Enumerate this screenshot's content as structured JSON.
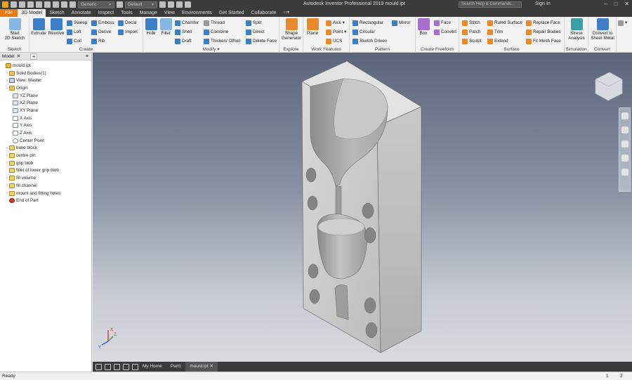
{
  "window": {
    "title": "Autodesk Inventor Professional 2019   mould.ipt",
    "search_placeholder": "Search Help & Commands...",
    "signin": "Sign In",
    "material": "Generic",
    "appearance": "Default"
  },
  "menu": {
    "tabs": [
      "File",
      "3D Model",
      "Sketch",
      "Annotate",
      "Inspect",
      "Tools",
      "Manage",
      "View",
      "Environments",
      "Get Started",
      "Collaborate"
    ]
  },
  "ribbon": {
    "sketch": {
      "label": "Sketch",
      "start": "Start\n2D Sketch"
    },
    "create": {
      "label": "Create",
      "extrude": "Extrude",
      "revolve": "Revolve",
      "sweep": "Sweep",
      "loft": "Loft",
      "coil": "Coil",
      "emboss": "Emboss",
      "derive": "Derive",
      "rib": "Rib",
      "decal": "Decal",
      "import": "Import"
    },
    "modify": {
      "label": "Modify ▾",
      "hole": "Hole",
      "fillet": "Fillet",
      "chamfer": "Chamfer",
      "shell": "Shell",
      "draft": "Draft",
      "thread": "Thread",
      "combine": "Combine",
      "thicken": "Thicken/ Offset",
      "split": "Split",
      "direct": "Direct",
      "delete_face": "Delete Face"
    },
    "explore": {
      "label": "Explore",
      "shape_gen": "Shape\nGenerator"
    },
    "work": {
      "label": "Work Features",
      "plane": "Plane",
      "axis": "Axis ▾",
      "point": "Point ▾",
      "ucs": "UCS"
    },
    "pattern": {
      "label": "Pattern",
      "rectangular": "Rectangular",
      "circular": "Circular",
      "sketch_driven": "Sketch Driven",
      "mirror": "Mirror"
    },
    "freeform": {
      "label": "Create Freeform",
      "box": "Box",
      "face": "Face",
      "convert": "Convert"
    },
    "surface": {
      "label": "Surface",
      "stitch": "Stitch",
      "patch": "Patch",
      "sculpt": "Sculpt",
      "ruled": "Ruled Surface",
      "trim": "Trim",
      "extend": "Extend",
      "replace_face": "Replace Face",
      "repair": "Repair Bodies",
      "fit_mesh": "Fit Mesh Face"
    },
    "simulation": {
      "label": "Simulation",
      "stress": "Stress\nAnalysis"
    },
    "convert": {
      "label": "Convert",
      "sheet_metal": "Convert to\nSheet Metal"
    }
  },
  "browser": {
    "tab": "Model",
    "add": "+",
    "menu": "≡",
    "items": [
      {
        "label": "mould.ipt",
        "indent": 0,
        "icon": "part"
      },
      {
        "label": "Solid Bodies(1)",
        "indent": 1,
        "icon": "folder",
        "exp": "›"
      },
      {
        "label": "View: Master",
        "indent": 1,
        "icon": "view",
        "exp": "›"
      },
      {
        "label": "Origin",
        "indent": 1,
        "icon": "folder",
        "exp": "⌄"
      },
      {
        "label": "YZ Plane",
        "indent": 2,
        "icon": "plane"
      },
      {
        "label": "XZ Plane",
        "indent": 2,
        "icon": "plane"
      },
      {
        "label": "XY Plane",
        "indent": 2,
        "icon": "plane"
      },
      {
        "label": "X Axis",
        "indent": 2,
        "icon": "axis"
      },
      {
        "label": "Y Axis",
        "indent": 2,
        "icon": "axis"
      },
      {
        "label": "Z Axis",
        "indent": 2,
        "icon": "axis"
      },
      {
        "label": "Center Point",
        "indent": 2,
        "icon": "point"
      },
      {
        "label": "base block",
        "indent": 1,
        "icon": "feat",
        "exp": "›"
      },
      {
        "label": "centre pin",
        "indent": 1,
        "icon": "feat",
        "exp": "›"
      },
      {
        "label": "grip blob",
        "indent": 1,
        "icon": "feat",
        "exp": "›"
      },
      {
        "label": "fillet of lower grip blob",
        "indent": 1,
        "icon": "feat"
      },
      {
        "label": "fill volume",
        "indent": 1,
        "icon": "feat",
        "exp": "›"
      },
      {
        "label": "fill channel",
        "indent": 1,
        "icon": "feat",
        "exp": "›"
      },
      {
        "label": "mount and fitting holes",
        "indent": 1,
        "icon": "feat",
        "exp": "›"
      },
      {
        "label": "End of Part",
        "indent": 1,
        "icon": "end"
      }
    ]
  },
  "doc_tabs": [
    "My Home",
    "Part1",
    "mould.ipt ✕"
  ],
  "status": {
    "text": "Ready",
    "n1": "1",
    "n2": "2"
  },
  "triad": {
    "x": "X",
    "y": "Y",
    "z": "Z"
  }
}
